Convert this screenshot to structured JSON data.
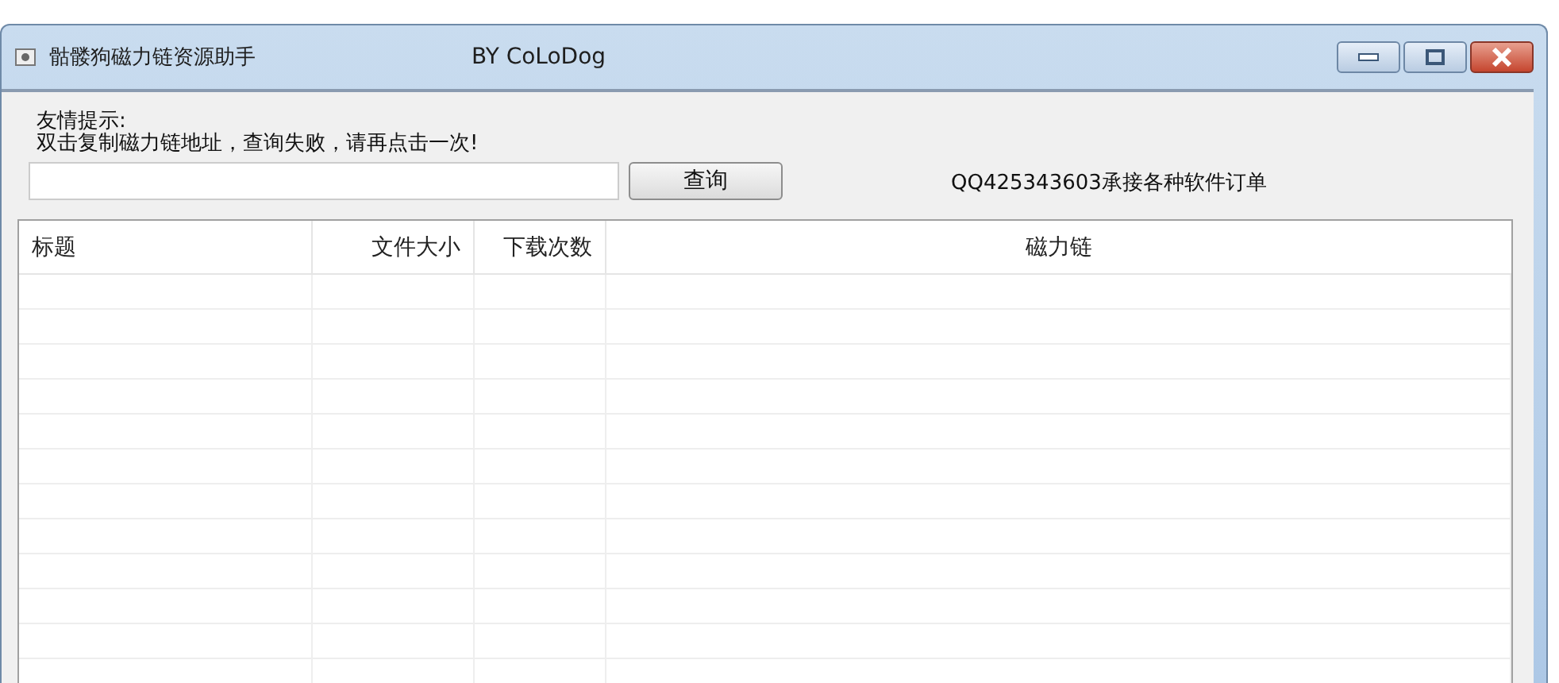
{
  "window": {
    "title": "骷髅狗磁力链资源助手",
    "subtitle": "BY CoLoDog"
  },
  "hint": {
    "heading": "友情提示:",
    "text": "双击复制磁力链地址，查询失败，请再点击一次!"
  },
  "search": {
    "button": "查询"
  },
  "notice": "QQ425343603承接各种软件订单",
  "table": {
    "columns": [
      "标题",
      "文件大小",
      "下载次数",
      "磁力链"
    ]
  }
}
